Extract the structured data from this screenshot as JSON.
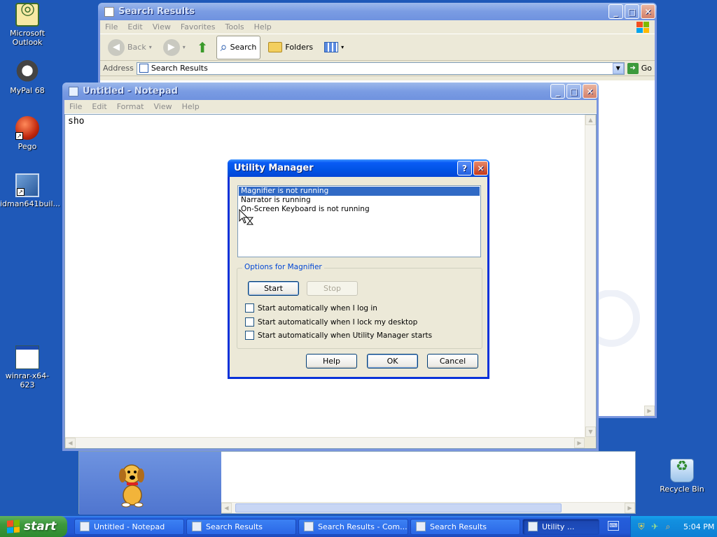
{
  "desktop": {
    "icons": [
      {
        "label": "Microsoft Outlook"
      },
      {
        "label": "MyPal 68"
      },
      {
        "label": "Pego"
      },
      {
        "label": "idman641buil..."
      },
      {
        "label": "winrar-x64-623"
      },
      {
        "label": "Recycle Bin"
      }
    ]
  },
  "explorer": {
    "title": "Search Results",
    "menu": [
      "File",
      "Edit",
      "View",
      "Favorites",
      "Tools",
      "Help"
    ],
    "toolbar": {
      "back": "Back",
      "search": "Search",
      "folders": "Folders"
    },
    "address_label": "Address",
    "address_value": "Search Results",
    "go": "Go"
  },
  "notepad": {
    "title": "Untitled - Notepad",
    "menu": [
      "File",
      "Edit",
      "Format",
      "View",
      "Help"
    ],
    "text": "sho"
  },
  "utility_manager": {
    "title": "Utility Manager",
    "list": [
      "Magnifier is not running",
      "Narrator is running",
      "On-Screen Keyboard is not running"
    ],
    "selected_index": 0,
    "group_label": "Options for Magnifier",
    "start": "Start",
    "stop": "Stop",
    "options": [
      "Start automatically when I log in",
      "Start automatically when I lock my desktop",
      "Start automatically when Utility Manager starts"
    ],
    "help": "Help",
    "ok": "OK",
    "cancel": "Cancel"
  },
  "taskbar": {
    "start": "start",
    "tasks": [
      {
        "label": "Untitled - Notepad"
      },
      {
        "label": "Search Results"
      },
      {
        "label": "Search Results - Com..."
      },
      {
        "label": "Search Results"
      },
      {
        "label": "Utility ..."
      }
    ],
    "clock": "5:04 PM"
  }
}
